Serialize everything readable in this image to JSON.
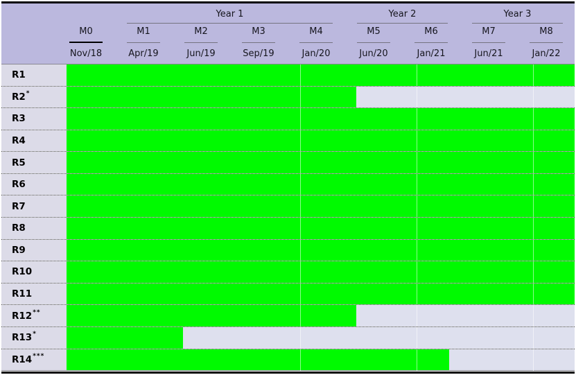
{
  "chart_data": {
    "type": "gantt",
    "title": "",
    "columns": [
      {
        "id": "M0",
        "date": "Nov/18",
        "highlight": true
      },
      {
        "id": "M1",
        "date": "Apr/19",
        "highlight": false
      },
      {
        "id": "M2",
        "date": "Jun/19",
        "highlight": false
      },
      {
        "id": "M3",
        "date": "Sep/19",
        "highlight": false
      },
      {
        "id": "M4",
        "date": "Jan/20",
        "highlight": false
      },
      {
        "id": "M5",
        "date": "Jun/20",
        "highlight": false
      },
      {
        "id": "M6",
        "date": "Jan/21",
        "highlight": false
      },
      {
        "id": "M7",
        "date": "Jun/21",
        "highlight": false
      },
      {
        "id": "M8",
        "date": "Jan/22",
        "highlight": false
      }
    ],
    "year_groups": [
      {
        "label": "Year 1",
        "col_from": 1,
        "col_to": 4
      },
      {
        "label": "Year 2",
        "col_from": 5,
        "col_to": 6
      },
      {
        "label": "Year 3",
        "col_from": 7,
        "col_to": 8
      }
    ],
    "rows": [
      {
        "label": "R1",
        "sup": "",
        "start_pct": 0,
        "end_pct": 100
      },
      {
        "label": "R2",
        "sup": "*",
        "start_pct": 0,
        "end_pct": 57
      },
      {
        "label": "R3",
        "sup": "",
        "start_pct": 0,
        "end_pct": 100
      },
      {
        "label": "R4",
        "sup": "",
        "start_pct": 0,
        "end_pct": 100
      },
      {
        "label": "R5",
        "sup": "",
        "start_pct": 0,
        "end_pct": 100
      },
      {
        "label": "R6",
        "sup": "",
        "start_pct": 0,
        "end_pct": 100
      },
      {
        "label": "R7",
        "sup": "",
        "start_pct": 0,
        "end_pct": 100
      },
      {
        "label": "R8",
        "sup": "",
        "start_pct": 0,
        "end_pct": 100
      },
      {
        "label": "R9",
        "sup": "",
        "start_pct": 0,
        "end_pct": 100
      },
      {
        "label": "R10",
        "sup": "",
        "start_pct": 0,
        "end_pct": 100
      },
      {
        "label": "R11",
        "sup": "",
        "start_pct": 0,
        "end_pct": 100
      },
      {
        "label": "R12",
        "sup": "**",
        "start_pct": 0,
        "end_pct": 57
      },
      {
        "label": "R13",
        "sup": "*",
        "start_pct": 0,
        "end_pct": 22.9
      },
      {
        "label": "R14",
        "sup": "***",
        "start_pct": 0,
        "end_pct": 75.3
      }
    ],
    "gridlines_pct": [
      46.0,
      68.9,
      91.8
    ],
    "colors": {
      "bar": "#00fa00",
      "track": "#dee0ee",
      "label_column": "#dcdbe8",
      "header_bg": "#bbb8de",
      "border": "#000000"
    },
    "layout_hints": {
      "legend": "none",
      "grid": "faint vertical lines over bar area, dotted row separators"
    }
  }
}
